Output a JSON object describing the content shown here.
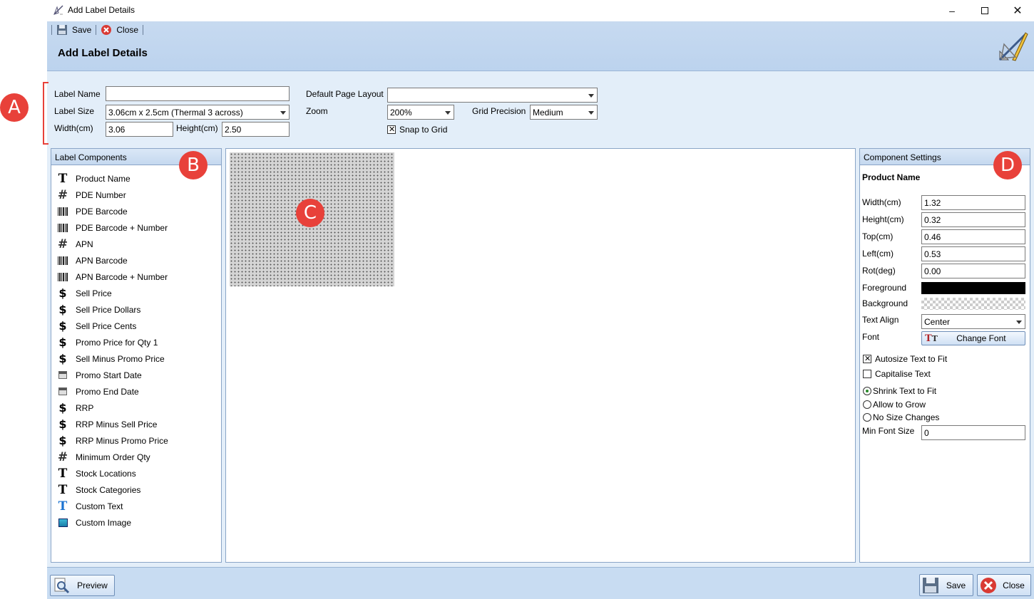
{
  "window": {
    "title": "Add Label Details"
  },
  "toolbar": {
    "save_label": "Save",
    "close_label": "Close"
  },
  "header": {
    "heading": "Add Label Details"
  },
  "annotations": {
    "a": "A",
    "b": "B",
    "c": "C",
    "d": "D"
  },
  "form": {
    "label_name": {
      "label": "Label Name",
      "value": ""
    },
    "label_size": {
      "label": "Label Size",
      "value": "3.06cm x 2.5cm (Thermal 3 across)"
    },
    "width": {
      "label": "Width(cm)",
      "value": "3.06"
    },
    "height": {
      "label": "Height(cm)",
      "value": "2.50"
    },
    "default_page_layout": {
      "label": "Default Page Layout",
      "value": ""
    },
    "zoom": {
      "label": "Zoom",
      "value": "200%"
    },
    "grid_precision": {
      "label": "Grid Precision",
      "value": "Medium"
    },
    "snap_to_grid": {
      "label": "Snap to Grid",
      "checked": true
    }
  },
  "components_panel": {
    "title": "Label Components",
    "items": [
      {
        "icon": "text-icon",
        "label": "Product Name"
      },
      {
        "icon": "hash-icon",
        "label": "PDE Number"
      },
      {
        "icon": "barcode-icon",
        "label": "PDE Barcode"
      },
      {
        "icon": "barcode-icon",
        "label": "PDE Barcode + Number"
      },
      {
        "icon": "hash-icon",
        "label": "APN"
      },
      {
        "icon": "barcode-icon",
        "label": "APN Barcode"
      },
      {
        "icon": "barcode-icon",
        "label": "APN Barcode + Number"
      },
      {
        "icon": "dollar-icon",
        "label": "Sell Price"
      },
      {
        "icon": "dollar-icon",
        "label": "Sell Price Dollars"
      },
      {
        "icon": "dollar-icon",
        "label": "Sell Price Cents"
      },
      {
        "icon": "dollar-icon",
        "label": "Promo Price for Qty 1"
      },
      {
        "icon": "dollar-icon",
        "label": "Sell Minus Promo Price"
      },
      {
        "icon": "calendar-icon",
        "label": "Promo Start Date"
      },
      {
        "icon": "calendar-icon",
        "label": "Promo End Date"
      },
      {
        "icon": "dollar-icon",
        "label": "RRP"
      },
      {
        "icon": "dollar-icon",
        "label": "RRP Minus Sell Price"
      },
      {
        "icon": "dollar-icon",
        "label": "RRP Minus Promo Price"
      },
      {
        "icon": "hash-icon",
        "label": "Minimum Order Qty"
      },
      {
        "icon": "text-icon",
        "label": "Stock Locations"
      },
      {
        "icon": "text-icon",
        "label": "Stock Categories"
      },
      {
        "icon": "custom-text-icon",
        "label": "Custom Text"
      },
      {
        "icon": "image-icon",
        "label": "Custom Image"
      }
    ]
  },
  "settings_panel": {
    "title": "Component Settings",
    "component": "Product Name",
    "fields": [
      {
        "label": "Width(cm)",
        "value": "1.32"
      },
      {
        "label": "Height(cm)",
        "value": "0.32"
      },
      {
        "label": "Top(cm)",
        "value": "0.46"
      },
      {
        "label": "Left(cm)",
        "value": "0.53"
      },
      {
        "label": "Rot(deg)",
        "value": "0.00"
      }
    ],
    "foreground_label": "Foreground",
    "foreground_color": "#000000",
    "background_label": "Background",
    "background_color": "transparent",
    "text_align_label": "Text Align",
    "text_align_value": "Center",
    "font_label": "Font",
    "change_font_label": "Change Font",
    "autosize_label": "Autosize Text to Fit",
    "autosize_checked": true,
    "capitalise_label": "Capitalise Text",
    "capitalise_checked": false,
    "size_mode_options": [
      "Shrink Text to Fit",
      "Allow to Grow",
      "No Size Changes"
    ],
    "size_mode_selected": "Shrink Text to Fit",
    "min_font_size_label": "Min Font Size",
    "min_font_size_value": "0"
  },
  "footer": {
    "preview_label": "Preview",
    "save_label": "Save",
    "close_label": "Close"
  },
  "colors": {
    "accent_badge": "#e8413a",
    "header_band": "#c7daf0",
    "window_body": "#e3eef9"
  }
}
